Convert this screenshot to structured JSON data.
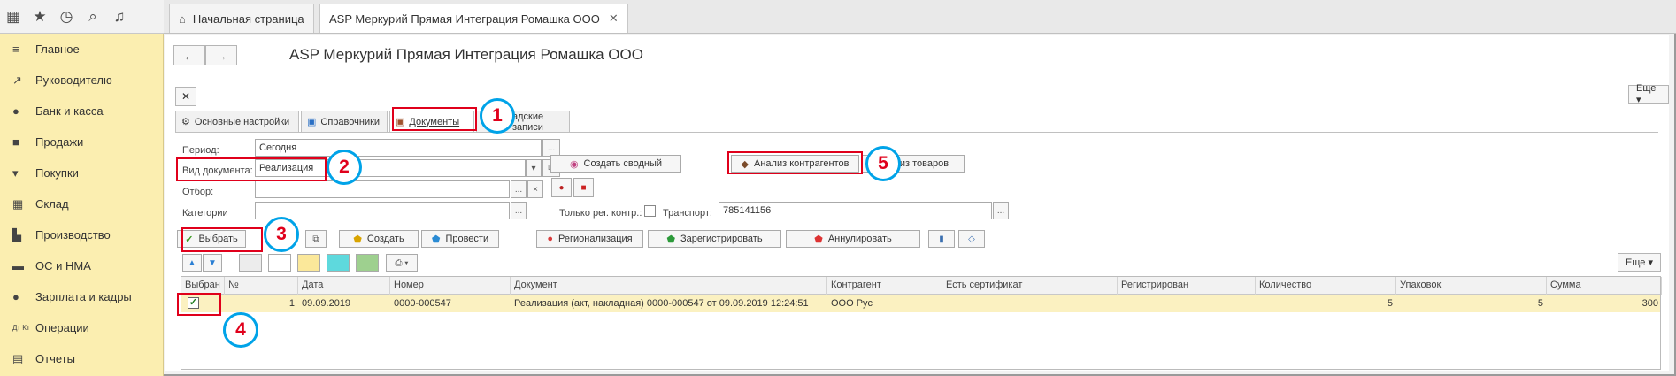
{
  "window": {
    "title": "ASP Меркурий Прямая Интеграция Ромашка ООО"
  },
  "top_icons": [
    "apps-grid-icon",
    "star-icon",
    "history-icon",
    "search-icon",
    "bell-icon"
  ],
  "window_tabs": [
    {
      "label": "Начальная страница",
      "icon": "home-icon"
    },
    {
      "label": "ASP Меркурий Прямая Интеграция Ромашка ООО",
      "close": "✕"
    }
  ],
  "sidebar": {
    "items": [
      {
        "label": "Главное",
        "icon": "menu-icon"
      },
      {
        "label": "Руководителю",
        "icon": "trend-icon"
      },
      {
        "label": "Банк и касса",
        "icon": "coin-icon"
      },
      {
        "label": "Продажи",
        "icon": "bag-icon"
      },
      {
        "label": "Покупки",
        "icon": "cart-icon"
      },
      {
        "label": "Склад",
        "icon": "warehouse-icon"
      },
      {
        "label": "Производство",
        "icon": "factory-icon"
      },
      {
        "label": "ОС и НМА",
        "icon": "truck-icon"
      },
      {
        "label": "Зарплата и кадры",
        "icon": "person-icon"
      },
      {
        "label": "Операции",
        "icon": "dt-kt-icon"
      },
      {
        "label": "Отчеты",
        "icon": "report-icon"
      }
    ]
  },
  "header": {
    "more_label": "Еще ▾"
  },
  "form_tabs": [
    {
      "label": "Основные настройки"
    },
    {
      "label": "Справочники"
    },
    {
      "label": "Документы"
    },
    {
      "label": "адские записи"
    }
  ],
  "filters": {
    "period_label": "Период:",
    "period_value": "Сегодня",
    "doc_type_label": "Вид документа:",
    "doc_type_value": "Реализация",
    "selection_label": "Отбор:",
    "category_label": "Категории",
    "only_reg_label": "Только рег. контр.:",
    "transport_label": "Транспорт:",
    "transport_value": "785141156",
    "ellipsis": "...",
    "clear": "×"
  },
  "buttons": {
    "create_summary": "Создать сводный",
    "analyze_contractors": "Анализ контрагентов",
    "analyze_goods": "Анализ товаров",
    "select": "Выбрать",
    "create": "Создать",
    "post": "Провести",
    "regionalize": "Регионализация",
    "register": "Зарегистрировать",
    "annul": "Аннулировать"
  },
  "table": {
    "more_label": "Еще ▾",
    "columns": [
      "Выбран",
      "№",
      "Дата",
      "Номер",
      "Документ",
      "Контрагент",
      "Есть сертификат",
      "Регистрирован",
      "Количество",
      "Упаковок",
      "Сумма"
    ],
    "rows": [
      {
        "selected": "✓",
        "num": "1",
        "date": "09.09.2019",
        "number": "0000-000547",
        "document": "Реализация (акт, накладная) 0000-000547 от 09.09.2019 12:24:51",
        "contractor": "ООО Рус",
        "certificate": "",
        "registered": "",
        "quantity": "5",
        "packages": "5",
        "sum": "300"
      }
    ]
  },
  "annotations": [
    "1",
    "2",
    "3",
    "4",
    "5"
  ],
  "colors": {
    "sidebar_bg": "#fbeeb0",
    "row_highlight": "#fbf1c1",
    "annotation_red": "#e0001b",
    "annotation_blue": "#00a3e8"
  }
}
